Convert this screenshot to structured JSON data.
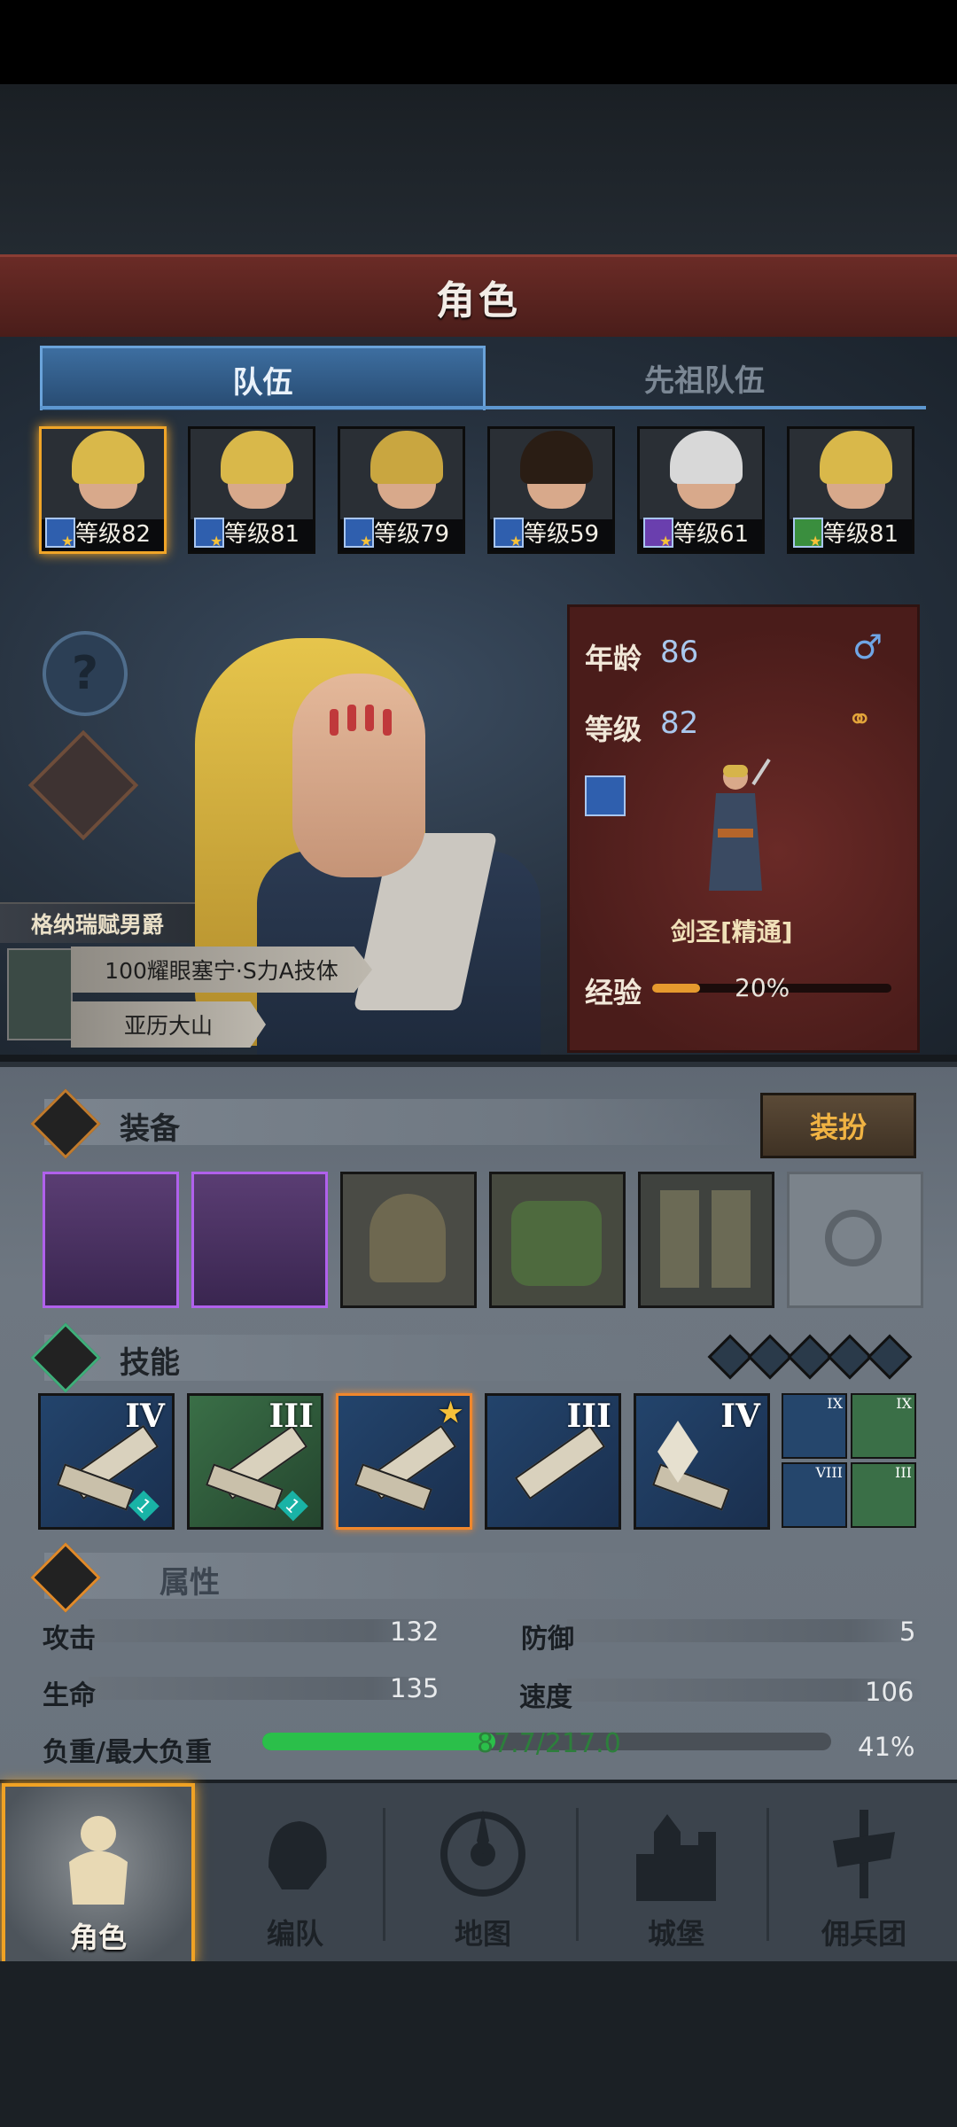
{
  "header": {
    "title": "角色"
  },
  "tabs": [
    {
      "label": "队伍",
      "active": true
    },
    {
      "label": "先祖队伍",
      "active": false
    }
  ],
  "roster": [
    {
      "level_text": "等级82",
      "hair": "#d9b84a",
      "class_color": "#2f5fae"
    },
    {
      "level_text": "等级81",
      "hair": "#d9b84a",
      "class_color": "#2f5fae"
    },
    {
      "level_text": "等级79",
      "hair": "#c9a640",
      "class_color": "#2f5fae"
    },
    {
      "level_text": "等级59",
      "hair": "#2a1d14",
      "class_color": "#2f5fae"
    },
    {
      "level_text": "等级61",
      "hair": "#d8d8d8",
      "class_color": "#6a3fae"
    },
    {
      "level_text": "等级81",
      "hair": "#d9b84a",
      "class_color": "#3a8e3e"
    }
  ],
  "hero": {
    "title": "格纳瑞赋男爵",
    "origin": "100耀眼塞宁·S力A技体",
    "birthplace": "亚历大山"
  },
  "info": {
    "age_label": "年龄",
    "age": "86",
    "gender_icon": "male-symbol",
    "gender_glyph": "♂",
    "level_label": "等级",
    "level": "82",
    "marriage_icon": "ring",
    "marriage_glyph": "⚭",
    "class_name": "剑圣[精通]",
    "exp_label": "经验",
    "exp_percent": 20,
    "exp_text": "20%"
  },
  "equipment": {
    "title": "装备",
    "dress_button": "装扮",
    "slots": [
      "weapon-greatsword",
      "weapon-greatsword",
      "hood",
      "armor",
      "boots",
      "ring-empty"
    ]
  },
  "skills": {
    "title": "技能",
    "gems_count": 5,
    "items": [
      {
        "rank": "IV",
        "color": "blue",
        "badge": "1"
      },
      {
        "rank": "III",
        "color": "green",
        "badge": "1"
      },
      {
        "rank": "★",
        "color": "blue",
        "badge": ""
      },
      {
        "rank": "III",
        "color": "blue",
        "badge": ""
      },
      {
        "rank": "IV",
        "color": "blue",
        "badge": ""
      }
    ],
    "small": [
      {
        "rank": "IX",
        "color": "blue"
      },
      {
        "rank": "IX",
        "color": "green"
      },
      {
        "rank": "VIII",
        "color": "blue"
      },
      {
        "rank": "III",
        "color": "green"
      }
    ]
  },
  "attributes": {
    "title": "属性",
    "attack_label": "攻击",
    "attack": "132",
    "defense_label": "防御",
    "defense": "5",
    "hp_label": "生命",
    "hp": "135",
    "speed_label": "速度",
    "speed": "106",
    "load_label": "负重/最大负重",
    "load": "87.7/217.0",
    "load_percent_text": "41%",
    "load_fraction": 0.41
  },
  "nav": [
    {
      "label": "角色",
      "icon": "knight-icon",
      "active": true
    },
    {
      "label": "编队",
      "icon": "helmet-icon",
      "active": false
    },
    {
      "label": "地图",
      "icon": "compass-icon",
      "active": false
    },
    {
      "label": "城堡",
      "icon": "castle-icon",
      "active": false
    },
    {
      "label": "佣兵团",
      "icon": "banner-icon",
      "active": false
    }
  ],
  "colors": {
    "accent_orange": "#f0a224",
    "tab_blue": "#3d6ea0",
    "header_red": "#6a2b26"
  }
}
